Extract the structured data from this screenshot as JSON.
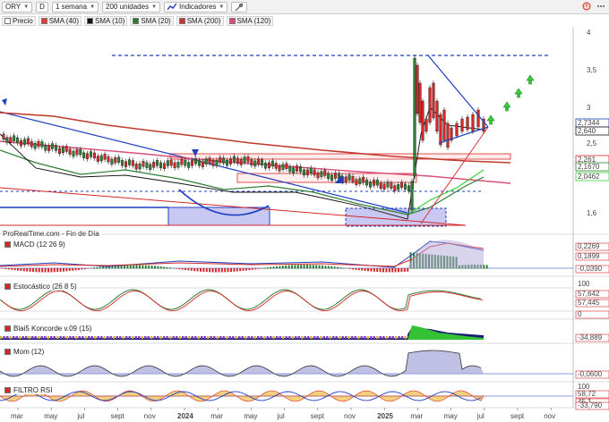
{
  "toolbar": {
    "symbol": "ORY",
    "period_badge": "D",
    "interval": "1 semana",
    "units": "200 unidades",
    "indicators": "Indicadores"
  },
  "legend": [
    {
      "label": "Precio",
      "color": "#ffffff"
    },
    {
      "label": "SMA (40)",
      "color": "#e03a3a"
    },
    {
      "label": "SMA (10)",
      "color": "#111111"
    },
    {
      "label": "SMA (20)",
      "color": "#2e7d32"
    },
    {
      "label": "SMA (200)",
      "color": "#c0392b"
    },
    {
      "label": "SMA (120)",
      "color": "#d94f7a"
    }
  ],
  "source": "ProRealTime.com - Fin de Día",
  "price_axis": {
    "ticks": [
      "4",
      "3,5",
      "3",
      "2,5",
      "1,6"
    ],
    "tags": [
      {
        "text": "2,7344",
        "color": "#1a3fb3"
      },
      {
        "text": "2,640",
        "color": "#111111"
      },
      {
        "text": "2,261",
        "color": "#d62728"
      },
      {
        "text": "2,1670",
        "color": "#2e7d32"
      },
      {
        "text": "2,0462",
        "color": "#3ad13a"
      }
    ]
  },
  "panels": {
    "macd": {
      "label": "MACD (12 26 9)",
      "ticks": [
        "0,2269",
        "0,1899",
        "-0,0390"
      ],
      "color": "#d62728"
    },
    "stoch": {
      "label": "Estocástico (26 8 5)",
      "ticks": [
        "100",
        "57,642",
        "57,445",
        "0"
      ],
      "color": "#d62728"
    },
    "blai5": {
      "label": "Blai5 Koncorde v.09 (15)",
      "ticks": [
        "-34,889"
      ],
      "color": "#d62728"
    },
    "mom": {
      "label": "Mom (12)",
      "ticks": [
        "-0,0600"
      ],
      "color": "#d62728"
    },
    "filtro": {
      "label": "FILTRO RSI",
      "ticks": [
        "100",
        "58,72",
        "45,1",
        "-33,790"
      ],
      "color": "#d62728"
    }
  },
  "time_axis": [
    "mar",
    "may",
    "jul",
    "sept",
    "nov",
    "2024",
    "mar",
    "may",
    "jul",
    "sept",
    "nov",
    "2025",
    "mar",
    "may",
    "jul",
    "sept",
    "nov"
  ],
  "colors": {
    "up": "#2e7d32",
    "down": "#d62728",
    "trend": "#1f3fbf",
    "zone": "#c8c8f2"
  }
}
